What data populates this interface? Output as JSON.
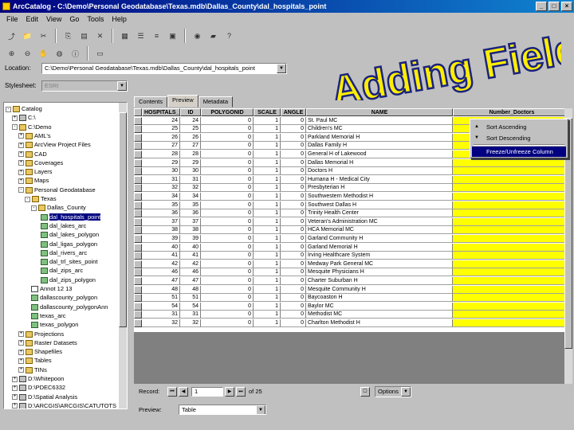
{
  "window": {
    "title": "ArcCatalog - C:\\Demo\\Personal Geodatabase\\Texas.mdb\\Dallas_County\\dal_hospitals_point",
    "min": "_",
    "max": "□",
    "close": "×"
  },
  "menu": [
    "File",
    "Edit",
    "View",
    "Go",
    "Tools",
    "Help"
  ],
  "overlay_title": "Adding Fields",
  "location": {
    "label": "Location:",
    "value": "C:\\Demo\\Personal Geodatabase\\Texas.mdb\\Dallas_County\\dal_hospitals_point"
  },
  "stylesheet": {
    "label": "Stylesheet:",
    "value": "ESRI"
  },
  "tree": {
    "items": [
      {
        "label": "Catalog",
        "icon": "folder",
        "exp": "-"
      },
      {
        "label": "C:\\",
        "icon": "drive",
        "exp": "+"
      },
      {
        "label": "C:\\Demo",
        "icon": "folder",
        "exp": "-"
      },
      {
        "label": "AML's",
        "icon": "folder",
        "exp": "+"
      },
      {
        "label": "ArcView Project Files",
        "icon": "folder",
        "exp": "+"
      },
      {
        "label": "CAD",
        "icon": "folder",
        "exp": "+"
      },
      {
        "label": "Coverages",
        "icon": "folder",
        "exp": "+"
      },
      {
        "label": "Layers",
        "icon": "folder",
        "exp": "+"
      },
      {
        "label": "Maps",
        "icon": "folder",
        "exp": "+"
      },
      {
        "label": "Personal Geodatabase",
        "icon": "folder",
        "exp": "-"
      },
      {
        "label": "Texas",
        "icon": "folder",
        "exp": "-"
      },
      {
        "label": "Dallas_County",
        "icon": "folder",
        "exp": "-"
      },
      {
        "label": "dal_hospitals_point",
        "icon": "layer",
        "exp": "",
        "selected": true
      },
      {
        "label": "dal_lakes_arc",
        "icon": "layer",
        "exp": ""
      },
      {
        "label": "dal_lakes_polygon",
        "icon": "layer",
        "exp": ""
      },
      {
        "label": "dal_ligas_polygon",
        "icon": "layer",
        "exp": ""
      },
      {
        "label": "dal_rivers_arc",
        "icon": "layer",
        "exp": ""
      },
      {
        "label": "dal_trl_sites_point",
        "icon": "layer",
        "exp": ""
      },
      {
        "label": "dal_zips_arc",
        "icon": "layer",
        "exp": ""
      },
      {
        "label": "dal_zips_polygon",
        "icon": "layer",
        "exp": ""
      },
      {
        "label": "Annot 12 13",
        "icon": "table",
        "exp": ""
      },
      {
        "label": "dallascounty_polygon",
        "icon": "layer",
        "exp": ""
      },
      {
        "label": "dallascounty_polygonAnn",
        "icon": "layer",
        "exp": ""
      },
      {
        "label": "texas_arc",
        "icon": "layer",
        "exp": ""
      },
      {
        "label": "texas_polygon",
        "icon": "layer",
        "exp": ""
      },
      {
        "label": "Projections",
        "icon": "folder",
        "exp": "+"
      },
      {
        "label": "Raster Datasets",
        "icon": "folder",
        "exp": "+"
      },
      {
        "label": "Shapefiles",
        "icon": "folder",
        "exp": "+"
      },
      {
        "label": "Tables",
        "icon": "folder",
        "exp": "+"
      },
      {
        "label": "TINs",
        "icon": "folder",
        "exp": "+"
      },
      {
        "label": "D:\\Whitepoon",
        "icon": "drive",
        "exp": "+"
      },
      {
        "label": "D:\\PDEC6332",
        "icon": "drive",
        "exp": "+"
      },
      {
        "label": "D:\\Spatial Analysis",
        "icon": "drive",
        "exp": "+"
      },
      {
        "label": "D:\\ARCGIS\\ARCGIS\\CATUTOTS",
        "icon": "drive",
        "exp": "+"
      }
    ]
  },
  "tabs": [
    "Contents",
    "Preview",
    "Metadata"
  ],
  "table": {
    "columns": [
      "HOSPITALS_",
      "ID",
      "POLYGONID",
      "SCALE",
      "ANGLE",
      "NAME",
      "Number_Doctors"
    ],
    "rows": [
      [
        "24",
        "24",
        "0",
        "1",
        "0",
        "St. Paul MC",
        ""
      ],
      [
        "25",
        "25",
        "0",
        "1",
        "0",
        "Children's MC",
        ""
      ],
      [
        "26",
        "26",
        "0",
        "1",
        "0",
        "Parkland Memorial H",
        ""
      ],
      [
        "27",
        "27",
        "0",
        "1",
        "0",
        "Dallas Family H",
        ""
      ],
      [
        "28",
        "28",
        "0",
        "1",
        "0",
        "General H of Lakewood",
        ""
      ],
      [
        "29",
        "29",
        "0",
        "1",
        "0",
        "Dallas Memorial H",
        ""
      ],
      [
        "30",
        "30",
        "0",
        "1",
        "0",
        "Doctors H",
        ""
      ],
      [
        "31",
        "31",
        "0",
        "1",
        "0",
        "Humana H - Medical City",
        ""
      ],
      [
        "32",
        "32",
        "0",
        "1",
        "0",
        "Presbyterian H",
        ""
      ],
      [
        "34",
        "34",
        "0",
        "1",
        "0",
        "Southwestern Methodist H",
        ""
      ],
      [
        "35",
        "35",
        "0",
        "1",
        "0",
        "Southwest Dallas H",
        ""
      ],
      [
        "36",
        "36",
        "0",
        "1",
        "0",
        "Trinity Health Center",
        ""
      ],
      [
        "37",
        "37",
        "0",
        "1",
        "0",
        "Veteran's Administration MC",
        ""
      ],
      [
        "38",
        "38",
        "0",
        "1",
        "0",
        "HCA Memorial MC",
        ""
      ],
      [
        "39",
        "39",
        "0",
        "1",
        "0",
        "Garland Community H",
        ""
      ],
      [
        "40",
        "40",
        "0",
        "1",
        "0",
        "Garland Memorial H",
        ""
      ],
      [
        "41",
        "41",
        "0",
        "1",
        "0",
        "Irving Healthcare System",
        ""
      ],
      [
        "42",
        "42",
        "0",
        "1",
        "0",
        "Medway Park General MC",
        ""
      ],
      [
        "46",
        "46",
        "0",
        "1",
        "0",
        "Mesquite Physicians H",
        ""
      ],
      [
        "47",
        "47",
        "0",
        "1",
        "0",
        "Charter Suburban H",
        ""
      ],
      [
        "48",
        "48",
        "0",
        "1",
        "0",
        "Mesquite Community H",
        ""
      ],
      [
        "51",
        "51",
        "0",
        "1",
        "0",
        "Baycoaston H",
        ""
      ],
      [
        "54",
        "54",
        "0",
        "1",
        "0",
        "Baylor MC",
        ""
      ],
      [
        "31",
        "31",
        "0",
        "1",
        "0",
        "Methodist MC",
        ""
      ],
      [
        "32",
        "32",
        "0",
        "1",
        "0",
        "Charlton Methodist H",
        ""
      ]
    ]
  },
  "context_menu": {
    "items": [
      "Sort Ascending",
      "Sort Descending",
      "Freeze/Unfreeze Column"
    ]
  },
  "record": {
    "label": "Record:",
    "value": "1",
    "of": "of 25",
    "options": "Options"
  },
  "preview": {
    "label": "Preview:",
    "value": "Table"
  },
  "colors": {
    "title_start": "#000080",
    "title_end": "#1084d0",
    "overlay_fill": "#ffee00",
    "overlay_stroke": "#1a237e",
    "highlight": "#ffff00"
  }
}
